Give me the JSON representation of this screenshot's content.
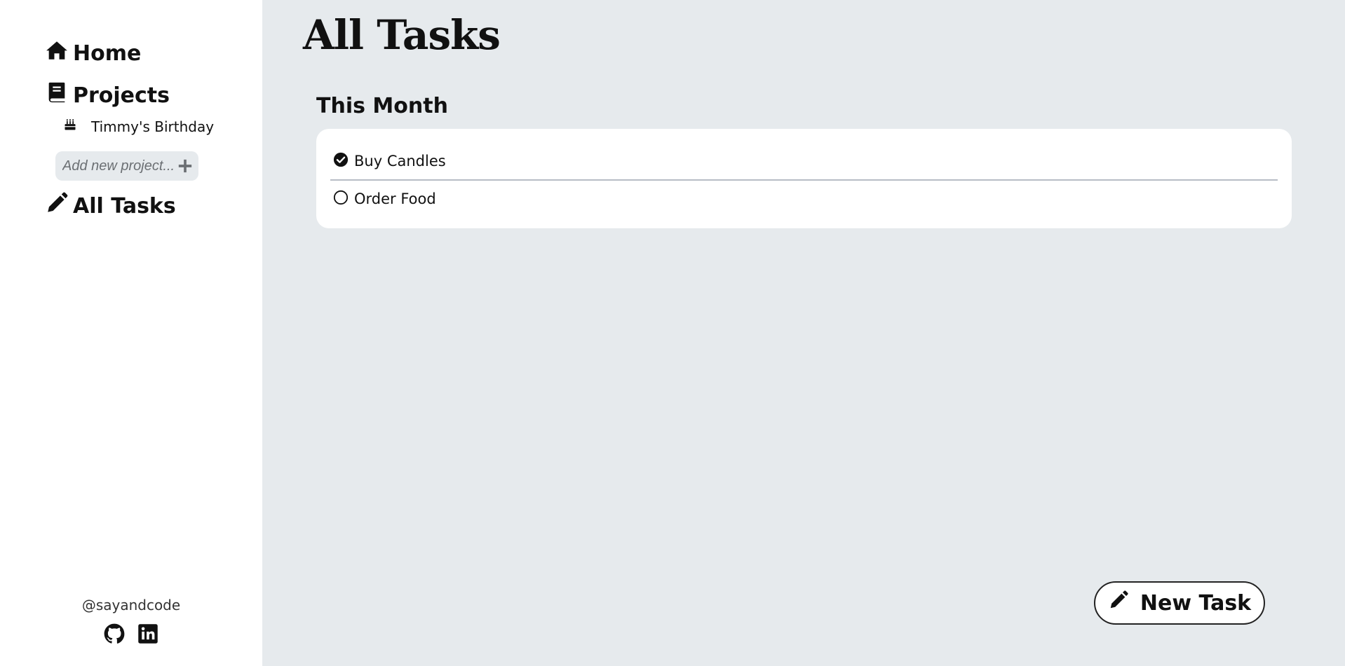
{
  "sidebar": {
    "nav": {
      "home": "Home",
      "projects": "Projects",
      "all_tasks": "All Tasks"
    },
    "projects": [
      {
        "label": "Timmy's Birthday",
        "icon": "birthday-cake-icon"
      }
    ],
    "add_project": {
      "placeholder": "Add new project...",
      "icon": "plus-icon"
    },
    "footer": {
      "handle": "@sayandcode",
      "links": [
        "github-icon",
        "linkedin-icon"
      ]
    }
  },
  "main": {
    "title": "All Tasks",
    "sections": [
      {
        "title": "This Month",
        "tasks": [
          {
            "label": "Buy Candles",
            "completed": true
          },
          {
            "label": "Order Food",
            "completed": false
          }
        ]
      }
    ],
    "new_task_label": "New Task"
  },
  "colors": {
    "main_background": "#e6eaed",
    "sidebar_background": "#ffffff",
    "card_background": "#ffffff",
    "text": "#111111",
    "divider": "#b7bcc5"
  }
}
